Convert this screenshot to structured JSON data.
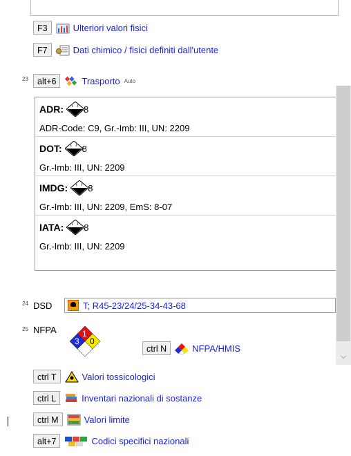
{
  "f3": {
    "key": "F3",
    "label": "Ulteriori valori fisici",
    "icon": "physical-values-icon"
  },
  "f7": {
    "key": "F7",
    "label": "Dati chimico / fisici definiti dall'utente",
    "icon": "user-data-icon"
  },
  "transport": {
    "num": "23",
    "key": "alt+6",
    "label": "Trasporto",
    "badge": "Auto",
    "items": [
      {
        "name": "ADR:",
        "class": "8",
        "detail": "ADR-Code: C9, Gr.-Imb: III, UN: 2209"
      },
      {
        "name": "DOT:",
        "class": "8",
        "detail": "Gr.-Imb: III, UN: 2209"
      },
      {
        "name": "IMDG:",
        "class": "8",
        "detail": "Gr.-Imb: III, UN: 2209, EmS: 8-07"
      },
      {
        "name": "IATA:",
        "class": "8",
        "detail": "Gr.-Imb: III, UN: 2209"
      }
    ]
  },
  "dsd": {
    "num": "24",
    "label": "DSD",
    "value": "T; R45-23/24/25-34-43-68"
  },
  "nfpa": {
    "num": "25",
    "label": "NFPA",
    "health": "3",
    "fire": "1",
    "reactivity": "0",
    "key": "ctrl N",
    "link": "NFPA/HMIS"
  },
  "shortcuts": [
    {
      "key": "ctrl T",
      "label": "Valori tossicologici",
      "icon": "toxicology-icon"
    },
    {
      "key": "ctrl L",
      "label": "Inventari nazionali di sostanze",
      "icon": "books-icon"
    },
    {
      "key": "ctrl M",
      "label": "Valori limite",
      "icon": "limit-values-icon"
    },
    {
      "key": "alt+7",
      "label": "Codici specifici nazionali",
      "icon": "flags-icon"
    }
  ],
  "colors": {
    "link": "#1b22d6",
    "nfpa_health": "#1d2fd1",
    "nfpa_fire": "#e01212",
    "nfpa_reactivity": "#f7e600"
  }
}
